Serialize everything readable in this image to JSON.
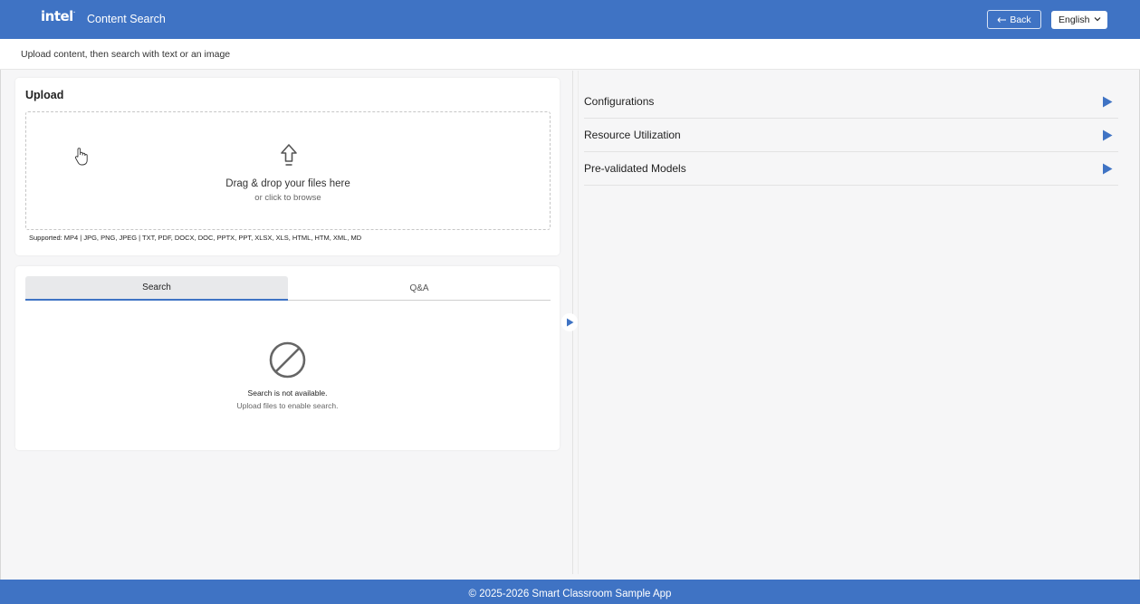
{
  "header": {
    "logo": "intel",
    "title": "Content Search",
    "back_label": "Back",
    "language": "English"
  },
  "subheader": {
    "text": "Upload content, then search with text or an image"
  },
  "upload": {
    "title": "Upload",
    "drop_main": "Drag & drop your files here",
    "drop_sub": "or click to browse",
    "supported": "Supported: MP4 | JPG, PNG, JPEG | TXT, PDF, DOCX, DOC, PPTX, PPT, XLSX, XLS, HTML, HTM, XML, MD"
  },
  "search": {
    "tabs": [
      {
        "label": "Search",
        "active": true
      },
      {
        "label": "Q&A",
        "active": false
      }
    ],
    "empty_title": "Search is not available.",
    "empty_sub": "Upload files to enable search."
  },
  "sidebar": {
    "items": [
      {
        "label": "Configurations"
      },
      {
        "label": "Resource Utilization"
      },
      {
        "label": "Pre-validated Models"
      }
    ]
  },
  "footer": {
    "text": "© 2025-2026 Smart Classroom Sample App"
  },
  "colors": {
    "brand": "#3f73c4",
    "background": "#f6f6f7"
  },
  "icons": [
    "upload-arrow-icon",
    "pointer-hand-icon",
    "no-entry-icon",
    "play-arrow-icon",
    "chevron-down-icon",
    "back-arrow-icon"
  ]
}
